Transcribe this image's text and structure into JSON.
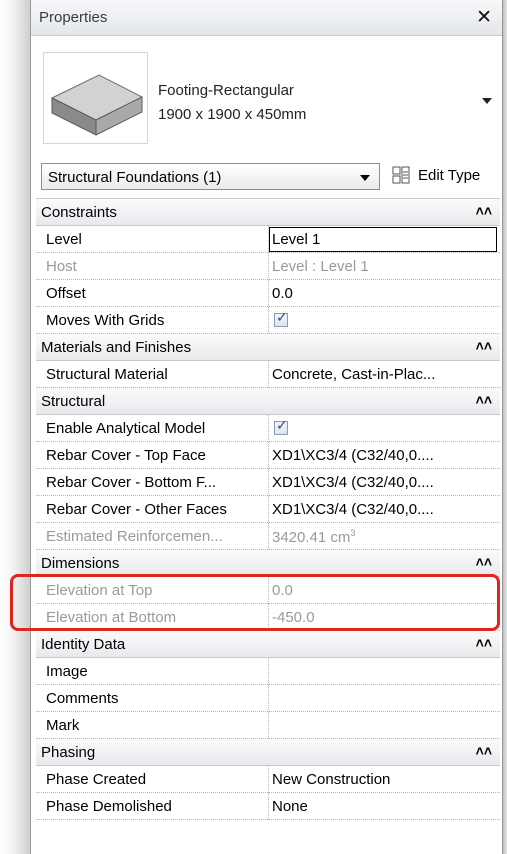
{
  "window": {
    "title": "Properties"
  },
  "type_selector": {
    "family": "Footing-Rectangular",
    "size": "1900 x 1900 x 450mm",
    "thumbnail_icon": "footing-box-icon"
  },
  "instance_selector": {
    "category": "Structural Foundations (1)"
  },
  "edit_type": {
    "label": "Edit Type",
    "icon": "edit-type-icon"
  },
  "collapse_glyph": "˄˄",
  "groups": {
    "constraints": {
      "label": "Constraints",
      "rows": [
        {
          "name": "Level",
          "value": "Level 1"
        },
        {
          "name": "Host",
          "value": "Level : Level 1"
        },
        {
          "name": "Offset",
          "value": "0.0"
        },
        {
          "name": "Moves With Grids",
          "checked": true
        }
      ]
    },
    "materials": {
      "label": "Materials and Finishes",
      "rows": [
        {
          "name": "Structural Material",
          "value": "Concrete, Cast-in-Plac..."
        }
      ]
    },
    "structural": {
      "label": "Structural",
      "rows": [
        {
          "name": "Enable Analytical Model",
          "checked": true
        },
        {
          "name": "Rebar Cover - Top Face",
          "value": "XD1\\XC3/4 (C32/40,0...."
        },
        {
          "name": "Rebar Cover - Bottom F...",
          "value": "XD1\\XC3/4 (C32/40,0...."
        },
        {
          "name": "Rebar Cover - Other Faces",
          "value": "XD1\\XC3/4 (C32/40,0...."
        },
        {
          "name": "Estimated Reinforcemen...",
          "value": "3420.41 cm",
          "unit_sup": "3"
        }
      ]
    },
    "dimensions": {
      "label": "Dimensions",
      "rows": [
        {
          "name": "Elevation at Top",
          "value": "0.0"
        },
        {
          "name": "Elevation at Bottom",
          "value": "-450.0"
        }
      ]
    },
    "identity": {
      "label": "Identity Data",
      "rows": [
        {
          "name": "Image",
          "value": ""
        },
        {
          "name": "Comments",
          "value": ""
        },
        {
          "name": "Mark",
          "value": ""
        }
      ]
    },
    "phasing": {
      "label": "Phasing",
      "rows": [
        {
          "name": "Phase Created",
          "value": "New Construction"
        },
        {
          "name": "Phase Demolished",
          "value": "None"
        }
      ]
    }
  },
  "colors": {
    "highlight": "#e0241f",
    "readonly_text": "#9a9a9a",
    "checkbox_check": "#2a4e8a"
  }
}
